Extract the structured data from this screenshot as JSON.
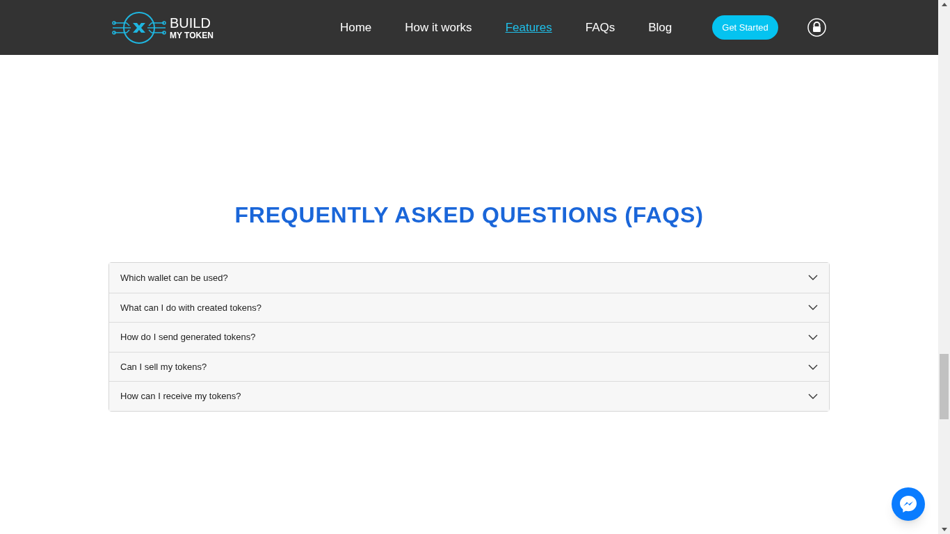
{
  "header": {
    "logo": {
      "line_1": "BUILD",
      "line_2": "MY TOKEN"
    },
    "nav": [
      {
        "label": "Home",
        "selected": false
      },
      {
        "label": "How it works",
        "selected": false
      },
      {
        "label": "Features",
        "selected": true
      },
      {
        "label": "FAQs",
        "selected": false
      },
      {
        "label": "Blog",
        "selected": false
      }
    ],
    "cta": "Get Started"
  },
  "faq": {
    "title": "FREQUENTLY ASKED QUESTIONS (FAQS)",
    "items": [
      {
        "question": "Which wallet can be used?",
        "expanded": false
      },
      {
        "question": "What can I do with created tokens?",
        "expanded": false
      },
      {
        "question": "How do I send generated tokens?",
        "expanded": false
      },
      {
        "question": "Can I sell my tokens?",
        "expanded": false
      },
      {
        "question": "How can I receive my tokens?",
        "expanded": false
      }
    ]
  }
}
